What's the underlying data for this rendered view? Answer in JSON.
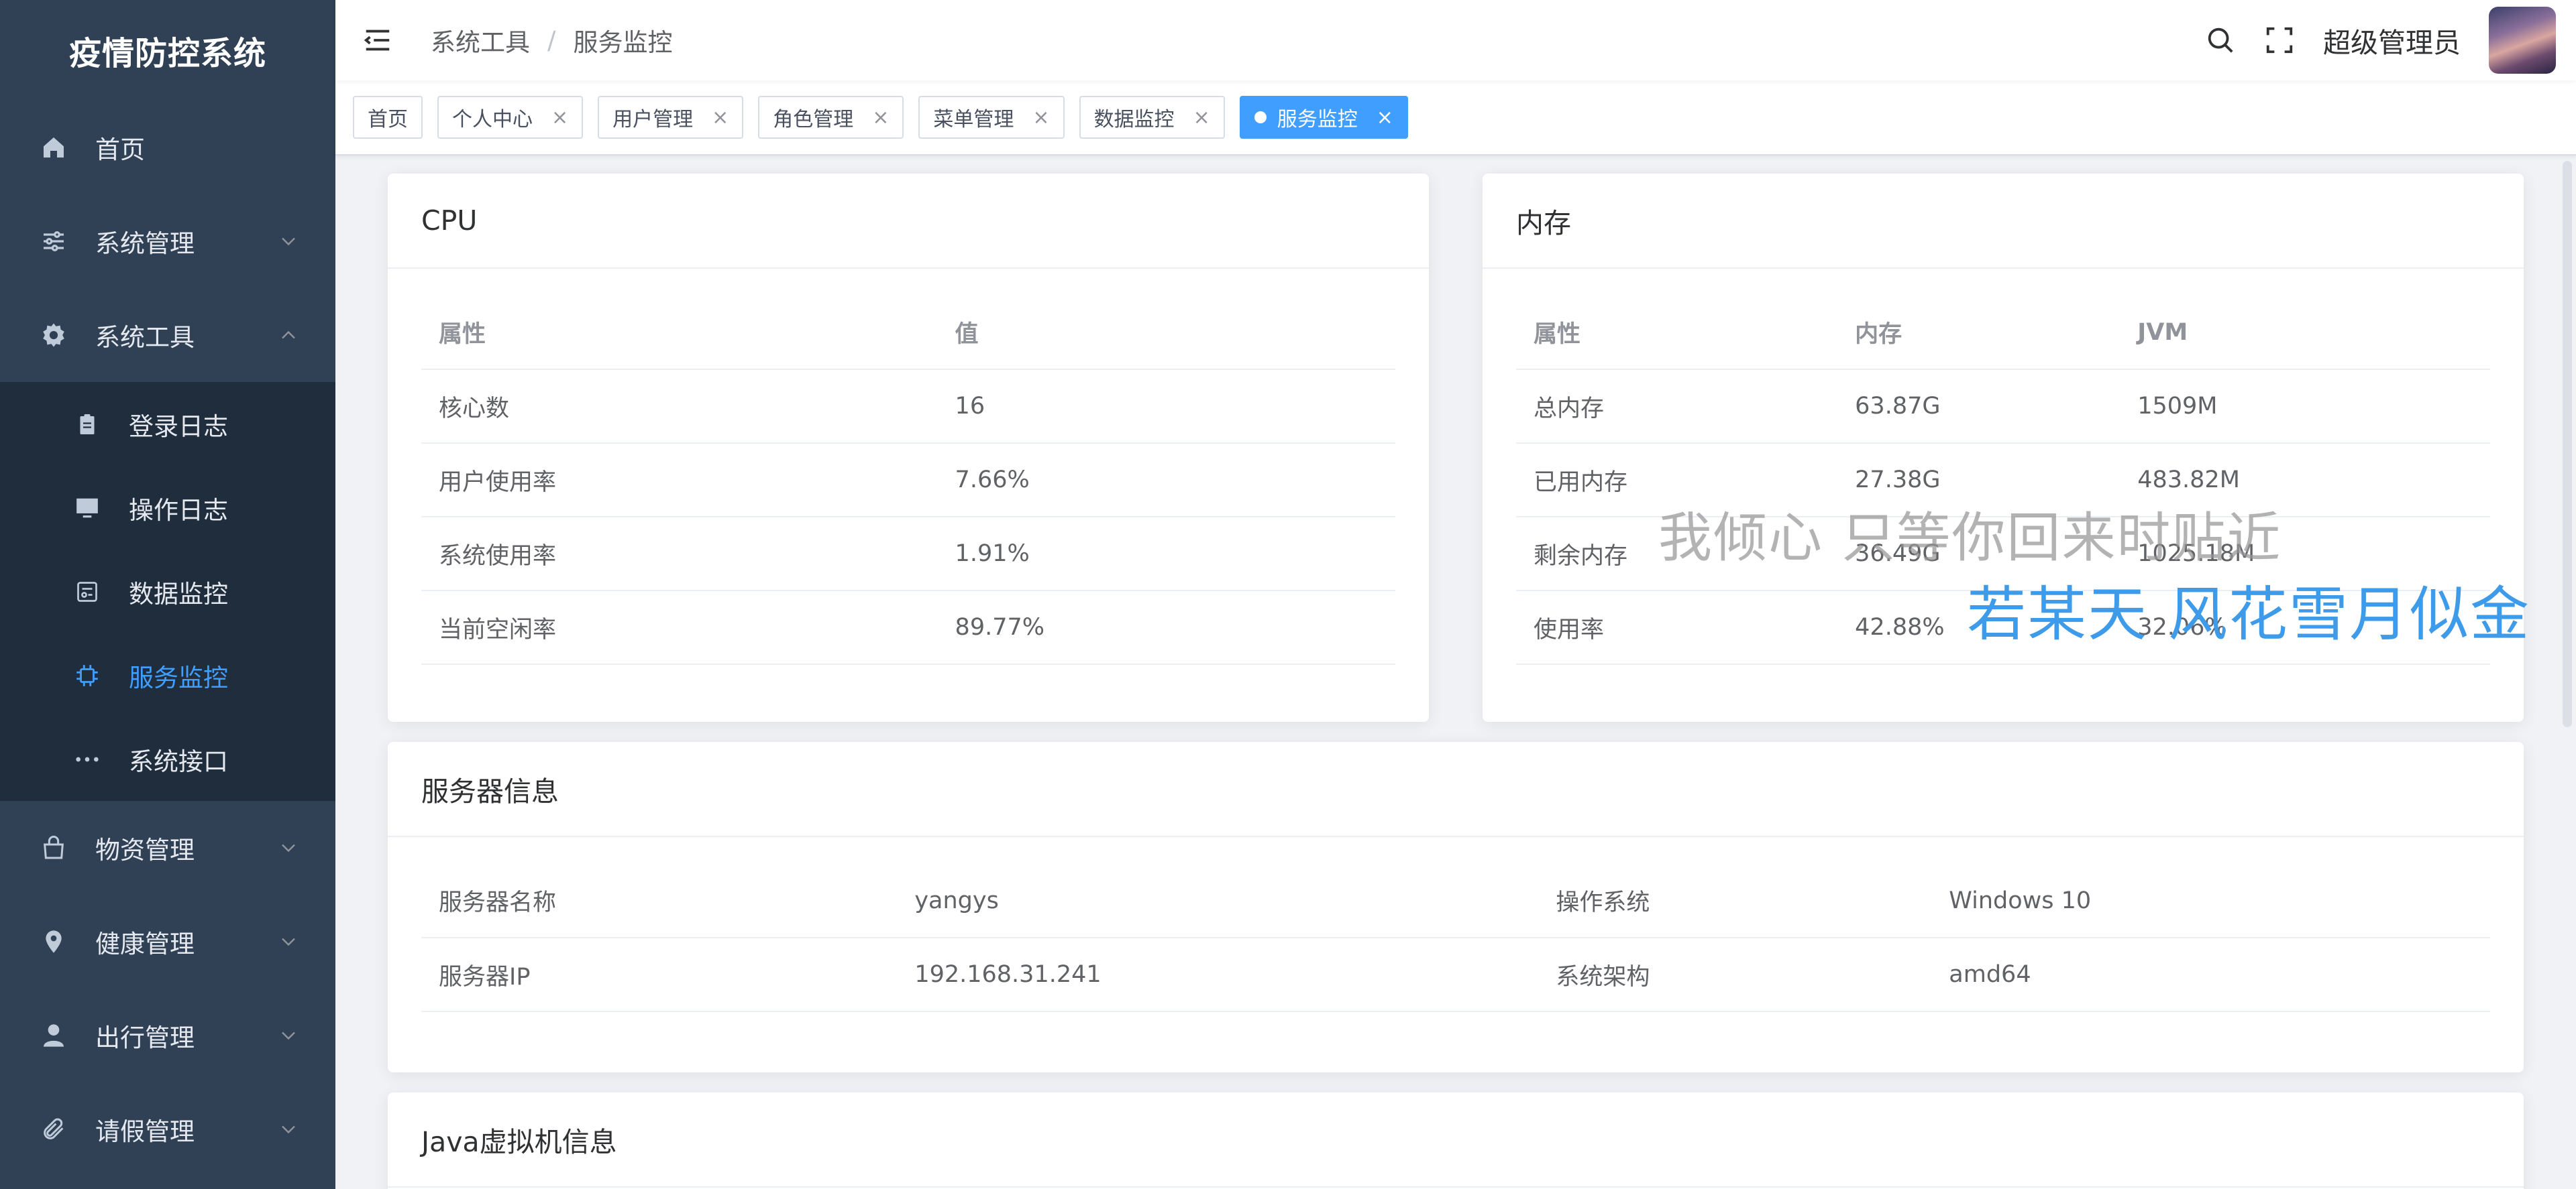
{
  "app": {
    "title": "疫情防控系统"
  },
  "sidebar": {
    "items": [
      {
        "label": "首页",
        "icon": "home-icon"
      },
      {
        "label": "系统管理",
        "icon": "sliders-icon"
      },
      {
        "label": "系统工具",
        "icon": "gear-icon"
      },
      {
        "label": "物资管理",
        "icon": "bag-icon"
      },
      {
        "label": "健康管理",
        "icon": "location-icon"
      },
      {
        "label": "出行管理",
        "icon": "user-icon"
      },
      {
        "label": "请假管理",
        "icon": "paperclip-icon"
      }
    ],
    "submenu": [
      {
        "label": "登录日志",
        "icon": "clipboard-icon"
      },
      {
        "label": "操作日志",
        "icon": "monitor-icon"
      },
      {
        "label": "数据监控",
        "icon": "database-icon"
      },
      {
        "label": "服务监控",
        "icon": "cpu-icon",
        "active": true
      },
      {
        "label": "系统接口",
        "icon": "more-icon"
      }
    ]
  },
  "navbar": {
    "breadcrumb": [
      "系统工具",
      "服务监控"
    ],
    "separator": "/",
    "username": "超级管理员"
  },
  "tags": [
    {
      "label": "首页",
      "closable": false
    },
    {
      "label": "个人中心",
      "closable": true
    },
    {
      "label": "用户管理",
      "closable": true
    },
    {
      "label": "角色管理",
      "closable": true
    },
    {
      "label": "菜单管理",
      "closable": true
    },
    {
      "label": "数据监控",
      "closable": true
    },
    {
      "label": "服务监控",
      "closable": true,
      "active": true
    }
  ],
  "close_glyph": "×",
  "cpu": {
    "title": "CPU",
    "headers": [
      "属性",
      "值"
    ],
    "rows": [
      [
        "核心数",
        "16"
      ],
      [
        "用户使用率",
        "7.66%"
      ],
      [
        "系统使用率",
        "1.91%"
      ],
      [
        "当前空闲率",
        "89.77%"
      ]
    ]
  },
  "memory": {
    "title": "内存",
    "headers": [
      "属性",
      "内存",
      "JVM"
    ],
    "rows": [
      [
        "总内存",
        "63.87G",
        "1509M"
      ],
      [
        "已用内存",
        "27.38G",
        "483.82M"
      ],
      [
        "剩余内存",
        "36.49G",
        "1025.18M"
      ],
      [
        "使用率",
        "42.88%",
        "32.06%"
      ]
    ]
  },
  "server": {
    "title": "服务器信息",
    "rows": [
      [
        "服务器名称",
        "yangys",
        "操作系统",
        "Windows 10"
      ],
      [
        "服务器IP",
        "192.168.31.241",
        "系统架构",
        "amd64"
      ]
    ]
  },
  "jvm": {
    "title": "Java虚拟机信息"
  },
  "watermark": {
    "line1": "我倾心 只等你回来时贴近",
    "line2": "若某天 风花雪月似金"
  },
  "colors": {
    "sidebar_bg": "#304156",
    "submenu_bg": "#1f2d3d",
    "accent": "#409eff"
  }
}
